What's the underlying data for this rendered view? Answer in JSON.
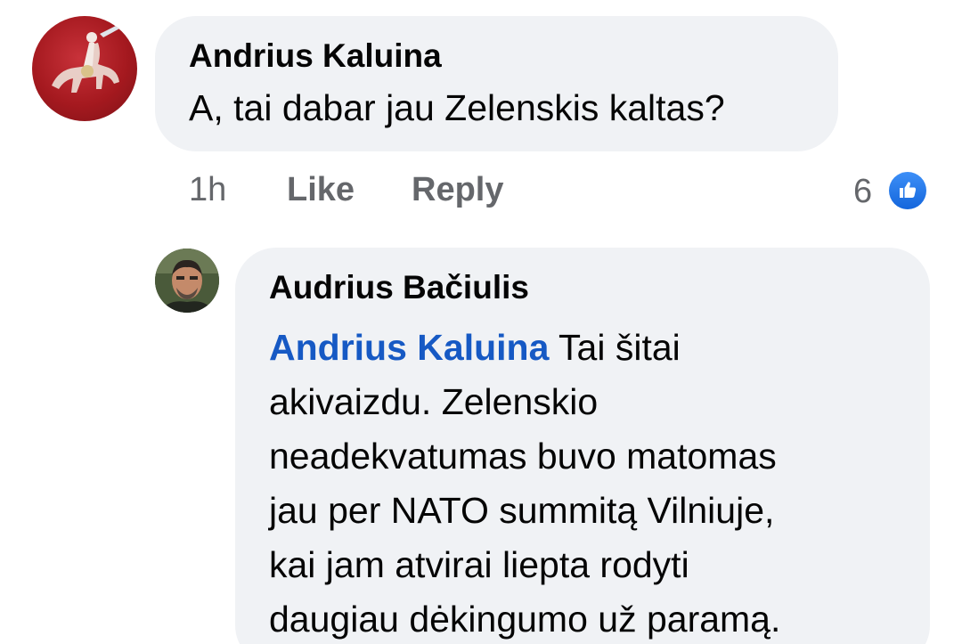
{
  "comment": {
    "author": "Andrius Kaluina",
    "text": "A, tai dabar jau Zelenskis kaltas?",
    "time": "1h",
    "like_label": "Like",
    "reply_label": "Reply",
    "reaction_count": "6",
    "reaction_icon": "thumbs-up-icon"
  },
  "reply": {
    "author": "Audrius Bačiulis",
    "mention": "Andrius Kaluina",
    "lines": [
      "Tai šitai",
      "akivaizdu. Zelenskio",
      "neadekvatumas buvo matomas",
      "jau per NATO summitą Vilniuje,",
      "kai jam atvirai liepta rodyti",
      "daugiau dėkingumo už paramą."
    ]
  },
  "colors": {
    "bubble": "#f0f2f5",
    "mention": "#1659c4",
    "meta_text": "#65676b",
    "like_badge": "#1877f2"
  }
}
